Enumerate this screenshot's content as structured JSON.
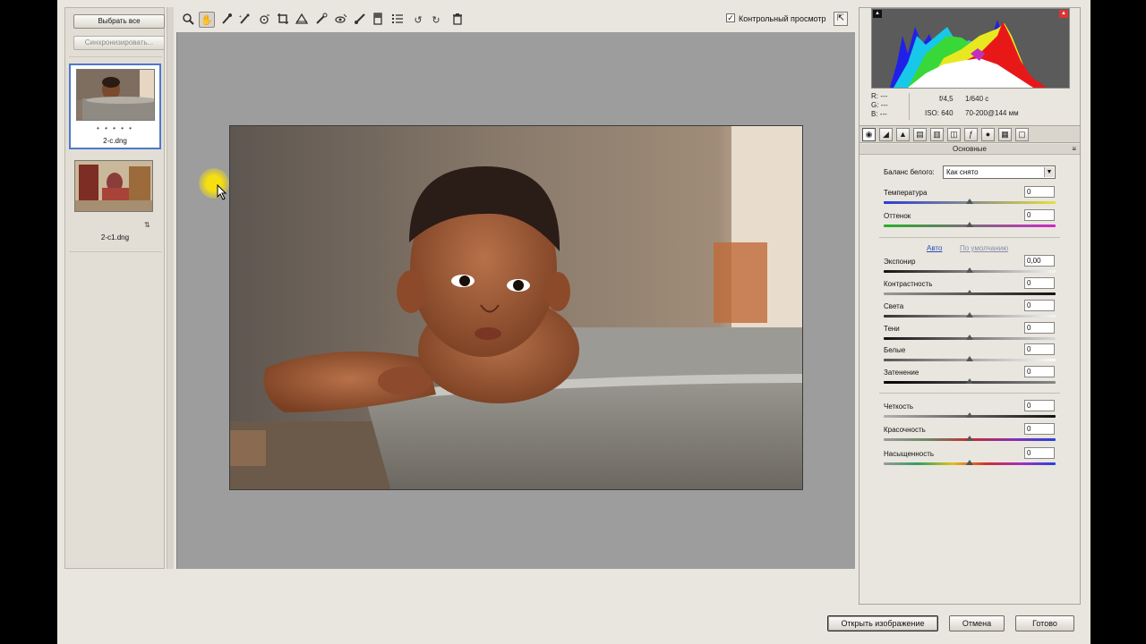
{
  "filmstrip": {
    "select_all_label": "Выбрать все",
    "sync_label": "Синхронизировать...",
    "items": [
      {
        "name": "2-c.dng",
        "rating": "• • • • •",
        "selected": true
      },
      {
        "name": "2-c1.dng",
        "selected": false
      }
    ]
  },
  "toolbar": {
    "tools": [
      "zoom-icon",
      "hand-icon",
      "white-balance-icon",
      "color-sampler-icon",
      "target-adjust-icon",
      "crop-icon",
      "straighten-icon",
      "spot-removal-icon",
      "red-eye-icon",
      "adjustment-brush-icon",
      "graduated-filter-icon",
      "preferences-icon",
      "rotate-left-icon",
      "rotate-right-icon",
      "trash-icon"
    ],
    "preview_checked": "✓",
    "preview_label": "Контрольный просмотр",
    "fullscreen_icon": "⇱"
  },
  "histogram": {
    "r_label": "R:",
    "g_label": "G:",
    "b_label": "B:",
    "r_value": "---",
    "g_value": "---",
    "b_value": "---",
    "aperture": "f/4,5",
    "shutter": "1/640 с",
    "iso": "ISO: 640",
    "lens": "70-200@144 мм"
  },
  "panel": {
    "section_title": "Основные",
    "section_menu_icon": "≡",
    "wb_label": "Баланс белого:",
    "wb_value": "Как снято",
    "auto_link": "Авто",
    "default_link": "По умолчанию",
    "temperature": {
      "label": "Температура",
      "value": "0"
    },
    "tint": {
      "label": "Оттенок",
      "value": "0"
    },
    "exposure": {
      "label": "Экспонир",
      "value": "0,00"
    },
    "contrast": {
      "label": "Контрастность",
      "value": "0"
    },
    "highlights": {
      "label": "Света",
      "value": "0"
    },
    "shadows": {
      "label": "Тени",
      "value": "0"
    },
    "whites": {
      "label": "Белые",
      "value": "0"
    },
    "blacks": {
      "label": "Затенение",
      "value": "0"
    },
    "clarity": {
      "label": "Четкость",
      "value": "0"
    },
    "vibrance": {
      "label": "Красочность",
      "value": "0"
    },
    "saturation": {
      "label": "Насыщенность",
      "value": "0"
    }
  },
  "buttons": {
    "open_image": "Открыть изображение",
    "cancel": "Отмена",
    "done": "Готово"
  },
  "colors": {
    "app_bg": "#e9e6df",
    "canvas_bg": "#9d9d9d",
    "selection": "#4d79c9",
    "link": "#2a4db3"
  }
}
